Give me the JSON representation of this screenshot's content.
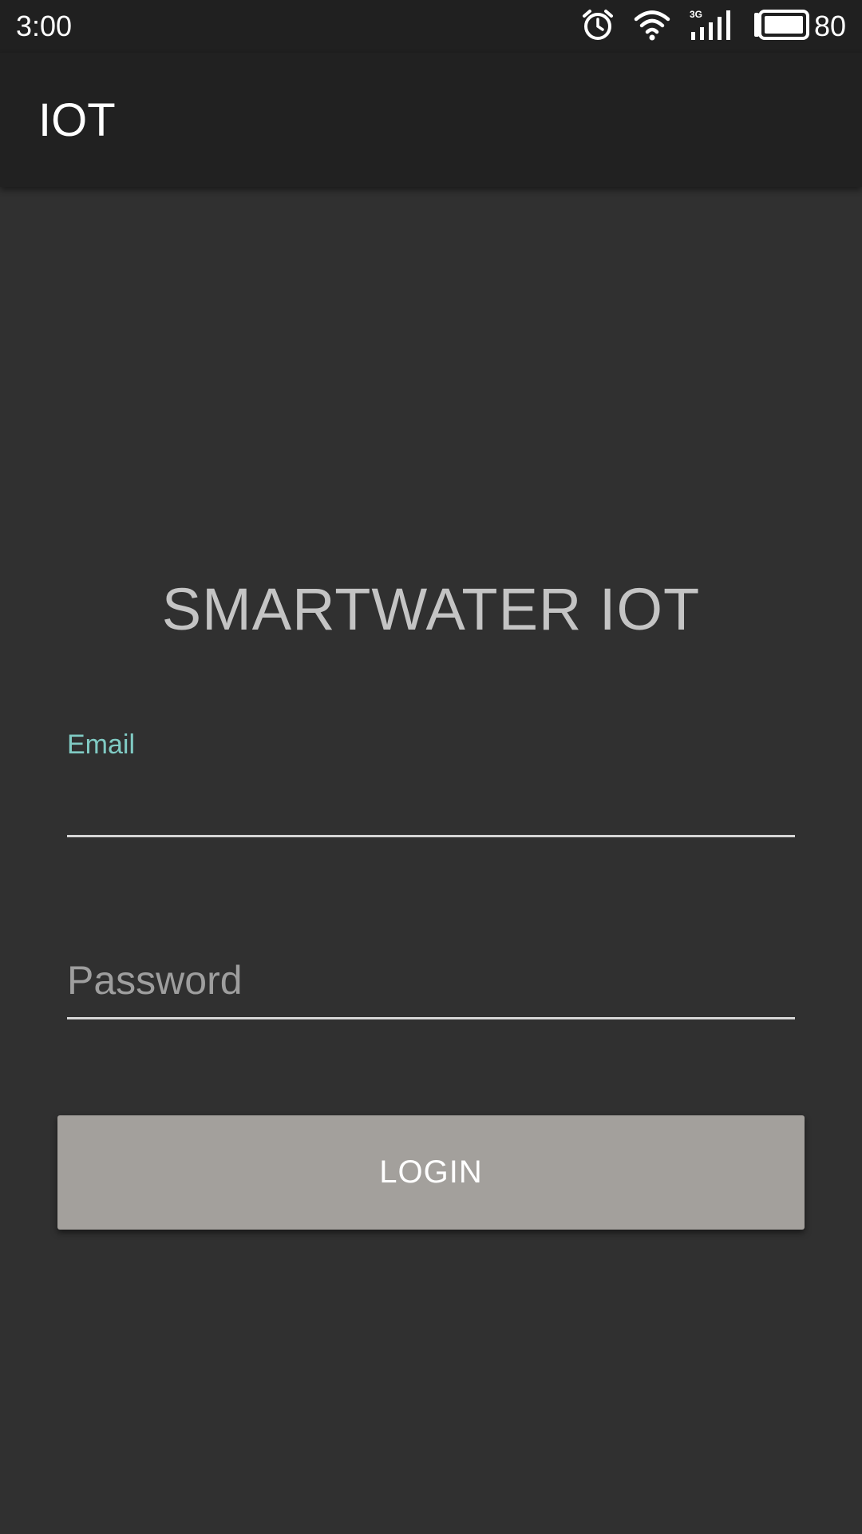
{
  "status_bar": {
    "time": "3:00",
    "battery_level": "80",
    "icons": [
      "alarm-icon",
      "wifi-icon",
      "cellular-3g-icon",
      "battery-icon"
    ],
    "network_type": "3G"
  },
  "app_bar": {
    "title": "IOT"
  },
  "main": {
    "heading": "SMARTWATER IOT",
    "email": {
      "label": "Email",
      "value": ""
    },
    "password": {
      "placeholder": "Password",
      "value": ""
    },
    "login_label": "LOGIN"
  },
  "colors": {
    "background": "#303030",
    "app_bar": "#212121",
    "status_bar": "#202020",
    "accent": "#80cbc4",
    "button": "#a3a09c",
    "heading": "#c4c4c4"
  }
}
